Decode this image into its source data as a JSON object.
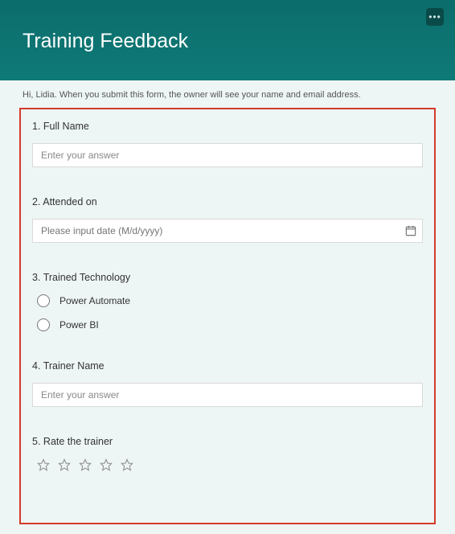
{
  "header": {
    "title": "Training Feedback"
  },
  "notice": "Hi, Lidia. When you submit this form, the owner will see your name and email address.",
  "questions": {
    "q1": {
      "number": "1.",
      "label": "Full Name",
      "placeholder": "Enter your answer"
    },
    "q2": {
      "number": "2.",
      "label": "Attended on",
      "placeholder": "Please input date (M/d/yyyy)"
    },
    "q3": {
      "number": "3.",
      "label": "Trained Technology",
      "options": [
        "Power Automate",
        "Power BI"
      ]
    },
    "q4": {
      "number": "4.",
      "label": "Trainer Name",
      "placeholder": "Enter your answer"
    },
    "q5": {
      "number": "5.",
      "label": "Rate the trainer"
    }
  }
}
